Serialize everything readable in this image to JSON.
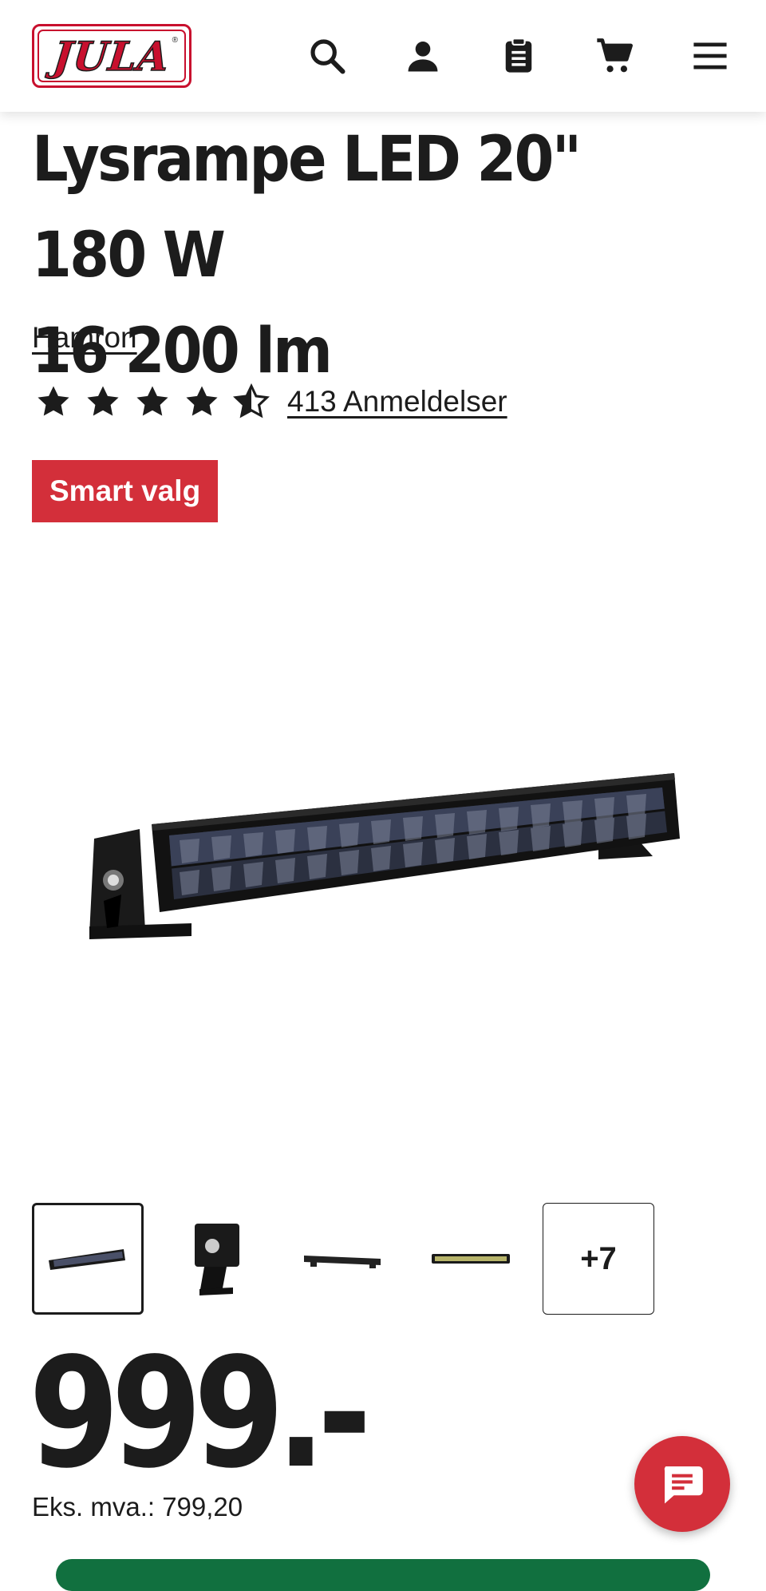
{
  "header": {
    "logo_text": "JULA",
    "logo_mark": "®",
    "icons": [
      "search-icon",
      "account-icon",
      "shopping-list-icon",
      "cart-icon",
      "menu-icon"
    ]
  },
  "product": {
    "title_line1": "Lysrampe LED 20\" 180 W",
    "title_line2": "16 200 lm",
    "brand": "Hamron",
    "rating": 4.5,
    "reviews_label": "413 Anmeldelser",
    "badge": "Smart valg",
    "image_icon": "led-light-bar-image",
    "thumbnails_more": "+7",
    "price": "999.-",
    "price_ex_vat": "Eks. mva.: 799,20"
  },
  "colors": {
    "brand_red": "#c8102e",
    "badge_red": "#d32f3a",
    "buy_green": "#11703f",
    "text": "#1c1c1c"
  }
}
